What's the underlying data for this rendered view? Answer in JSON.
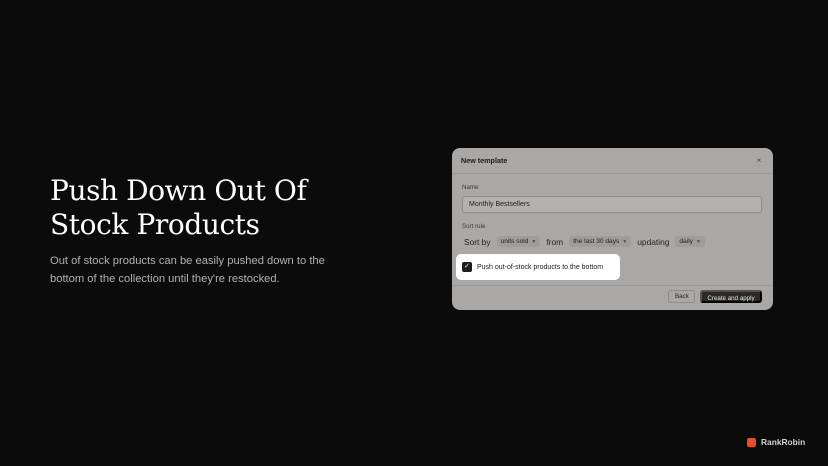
{
  "hero": {
    "title": "Push Down Out Of Stock Products",
    "description": "Out of stock products can be easily pushed down to the bottom of the collection until they're restocked."
  },
  "modal": {
    "title": "New template",
    "close_icon": "close-icon",
    "name_label": "Name",
    "name_value": "Monthly Bestsellers",
    "sort_rule_label": "Sort rule",
    "sort_by_word": "Sort by",
    "sort_by_value": "units sold",
    "from_word": "from",
    "from_value": "the last 30 days",
    "updating_word": "updating",
    "updating_value": "daily",
    "checkbox_label": "Push out-of-stock products to the bottom",
    "checkbox_checked": true,
    "back_label": "Back",
    "create_label": "Create and apply"
  },
  "brand": {
    "name": "RankRobin",
    "color": "#e0512b"
  }
}
